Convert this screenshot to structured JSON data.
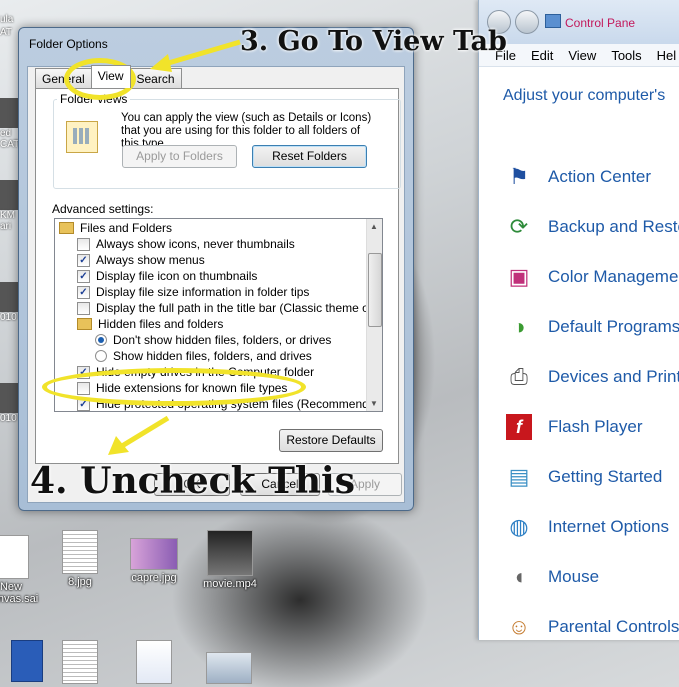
{
  "desktop": {
    "icons_row1": [
      {
        "label": "New\nCanvas.sai",
        "icon": "document-icon"
      },
      {
        "label": "8.jpg",
        "icon": "image-icon"
      },
      {
        "label": "capre.jpg",
        "icon": "image-icon"
      },
      {
        "label": "movie.mp4",
        "icon": "video-icon"
      }
    ],
    "left_strip_labels": [
      "ula",
      "AT",
      "ed",
      "CAT",
      "KM",
      "ari",
      "010",
      "010"
    ]
  },
  "control_panel": {
    "breadcrumb": "Control Pane",
    "menu": [
      "File",
      "Edit",
      "View",
      "Tools",
      "Hel"
    ],
    "heading": "Adjust your computer's",
    "items": [
      {
        "label": "Action Center",
        "icon": "flag-icon"
      },
      {
        "label": "Backup and Resto",
        "icon": "backup-icon"
      },
      {
        "label": "Color Manageme",
        "icon": "color-management-icon"
      },
      {
        "label": "Default Programs",
        "icon": "default-programs-icon"
      },
      {
        "label": "Devices and Print",
        "icon": "printer-icon"
      },
      {
        "label": "Flash Player",
        "icon": "flash-icon"
      },
      {
        "label": "Getting Started",
        "icon": "getting-started-icon"
      },
      {
        "label": "Internet Options",
        "icon": "globe-icon"
      },
      {
        "label": "Mouse",
        "icon": "mouse-icon"
      },
      {
        "label": "Parental Controls",
        "icon": "parental-controls-icon"
      }
    ]
  },
  "dialog": {
    "title": "Folder Options",
    "tabs": [
      "General",
      "View",
      "Search"
    ],
    "active_tab": "View",
    "folder_views": {
      "label": "Folder views",
      "description": "You can apply the view (such as Details or Icons) that you are using for this folder to all folders of this type.",
      "apply_button": "Apply to Folders",
      "reset_button": "Reset Folders"
    },
    "advanced_label": "Advanced settings:",
    "tree": [
      {
        "type": "folder",
        "label": "Files and Folders",
        "indent": 0
      },
      {
        "type": "checkbox",
        "label": "Always show icons, never thumbnails",
        "checked": false,
        "indent": 1
      },
      {
        "type": "checkbox",
        "label": "Always show menus",
        "checked": true,
        "indent": 1
      },
      {
        "type": "checkbox",
        "label": "Display file icon on thumbnails",
        "checked": true,
        "indent": 1
      },
      {
        "type": "checkbox",
        "label": "Display file size information in folder tips",
        "checked": true,
        "indent": 1
      },
      {
        "type": "checkbox",
        "label": "Display the full path in the title bar (Classic theme only)",
        "checked": false,
        "indent": 1
      },
      {
        "type": "folder",
        "label": "Hidden files and folders",
        "indent": 1
      },
      {
        "type": "radio",
        "label": "Don't show hidden files, folders, or drives",
        "checked": true,
        "indent": 2
      },
      {
        "type": "radio",
        "label": "Show hidden files, folders, and drives",
        "checked": false,
        "indent": 2
      },
      {
        "type": "checkbox",
        "label": "Hide empty drives in the Computer folder",
        "checked": true,
        "indent": 1
      },
      {
        "type": "checkbox",
        "label": "Hide extensions for known file types",
        "checked": false,
        "indent": 1
      },
      {
        "type": "checkbox",
        "label": "Hide protected operating system files (Recommended)",
        "checked": true,
        "indent": 1
      }
    ],
    "restore_button": "Restore Defaults",
    "ok_button": "OK",
    "cancel_button": "Cancel",
    "apply_button": "Apply"
  },
  "annotations": {
    "step3": "3. Go To View Tab",
    "step4": "4. Uncheck This",
    "highlight_color": "#f1e32a"
  }
}
